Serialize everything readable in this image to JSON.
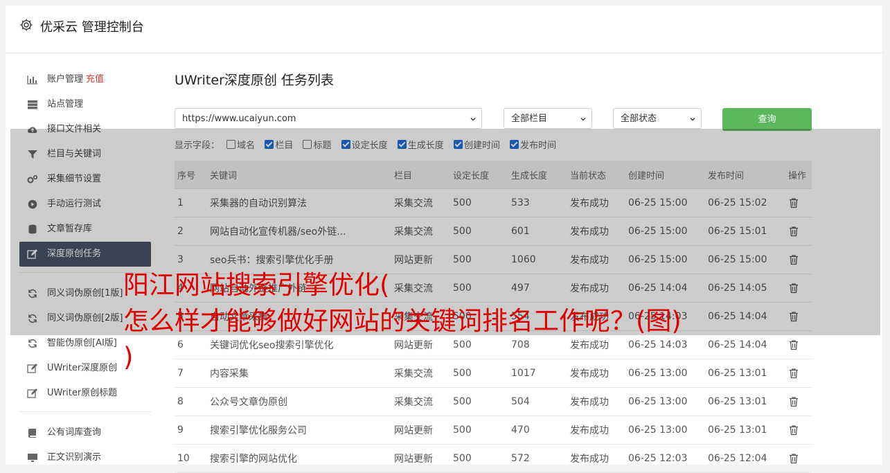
{
  "header": {
    "title": "优采云 管理控制台",
    "icon": "gear-icon"
  },
  "sidebar": {
    "items": [
      {
        "label": "账户管理",
        "badge": "充值",
        "icon": "bar-chart-icon"
      },
      {
        "label": "站点管理",
        "icon": "server-icon"
      },
      {
        "label": "接口文件相关",
        "icon": "cloud-upload-icon"
      },
      {
        "label": "栏目与关键词",
        "icon": "filter-icon"
      },
      {
        "label": "采集细节设置",
        "icon": "gears-icon"
      },
      {
        "label": "手动运行测试",
        "icon": "play-circle-icon"
      },
      {
        "label": "文章暂存库",
        "icon": "database-icon"
      },
      {
        "label": "深度原创任务",
        "icon": "edit-icon",
        "active": true
      },
      {
        "label": "同义词伪原创[1版]",
        "icon": "refresh-icon"
      },
      {
        "label": "同义词伪原创[2版]",
        "icon": "refresh-icon"
      },
      {
        "label": "智能伪原创[AI版]",
        "icon": "refresh-icon"
      },
      {
        "label": "UWriter深度原创",
        "icon": "edit-icon"
      },
      {
        "label": "UWriter原创标题",
        "icon": "edit-icon"
      },
      {
        "label": "公有词库查询",
        "icon": "book-icon"
      },
      {
        "label": "正文识别演示",
        "icon": "monitor-icon"
      }
    ]
  },
  "main": {
    "title": "UWriter深度原创 任务列表",
    "site_select": "https://www.ucaiyun.com",
    "column_select": "全部栏目",
    "status_select": "全部状态",
    "search_button": "查询",
    "fields_label": "显示字段：",
    "fields": [
      {
        "label": "域名",
        "checked": false
      },
      {
        "label": "栏目",
        "checked": true
      },
      {
        "label": "标题",
        "checked": false
      },
      {
        "label": "设定长度",
        "checked": true
      },
      {
        "label": "生成长度",
        "checked": true
      },
      {
        "label": "创建时间",
        "checked": true
      },
      {
        "label": "发布时间",
        "checked": true
      }
    ],
    "table": {
      "headers": [
        "序号",
        "关键词",
        "栏目",
        "设定长度",
        "生成长度",
        "当前状态",
        "创建时间",
        "发布时间",
        "操作"
      ],
      "rows": [
        [
          "1",
          "采集器的自动识别算法",
          "采集交流",
          "500",
          "533",
          "发布成功",
          "06-25 15:00",
          "06-25 15:02"
        ],
        [
          "2",
          "网站自动化宣传机器/seo外链...",
          "采集交流",
          "500",
          "601",
          "发布成功",
          "06-25 15:00",
          "06-25 15:01"
        ],
        [
          "3",
          "seo兵书：搜索引擎优化手册",
          "网站更新",
          "500",
          "1060",
          "发布成功",
          "06-25 15:00",
          "06-25 15:00"
        ],
        [
          "4",
          "网站自动外链推广外链",
          "采集交流",
          "500",
          "497",
          "发布成功",
          "06-25 14:04",
          "06-25 14:05"
        ],
        [
          "5",
          "自动文章采集",
          "采集交流",
          "500",
          "554",
          "发布成功",
          "06-25 14:03",
          "06-25 14:04"
        ],
        [
          "6",
          "关键词优化seo搜索引擎优化",
          "网站更新",
          "500",
          "708",
          "发布成功",
          "06-25 14:03",
          "06-25 14:04"
        ],
        [
          "7",
          "内容采集",
          "采集交流",
          "500",
          "1017",
          "发布成功",
          "06-25 13:00",
          "06-25 13:01"
        ],
        [
          "8",
          "公众号文章伪原创",
          "采集交流",
          "500",
          "504",
          "发布成功",
          "06-25 13:00",
          "06-25 13:01"
        ],
        [
          "9",
          "搜索引擎优化服务公司",
          "网站更新",
          "500",
          "470",
          "发布成功",
          "06-25 13:00",
          "06-25 13:01"
        ],
        [
          "10",
          "搜索引擎的网站优化",
          "网站更新",
          "500",
          "572",
          "发布成功",
          "06-25 12:03",
          "06-25 12:04"
        ]
      ]
    }
  },
  "overlay": {
    "headline_line1": "阳江网站搜索引擎优化(",
    "headline_line2": "怎么样才能够做好网站的关键词排名工作呢？(图)",
    "headline_line3": ")"
  },
  "colors": {
    "accent_green": "#5cb85c",
    "status_green": "#2e8b2e",
    "active_nav": "#4a5366",
    "headline_red": "#e00000"
  }
}
